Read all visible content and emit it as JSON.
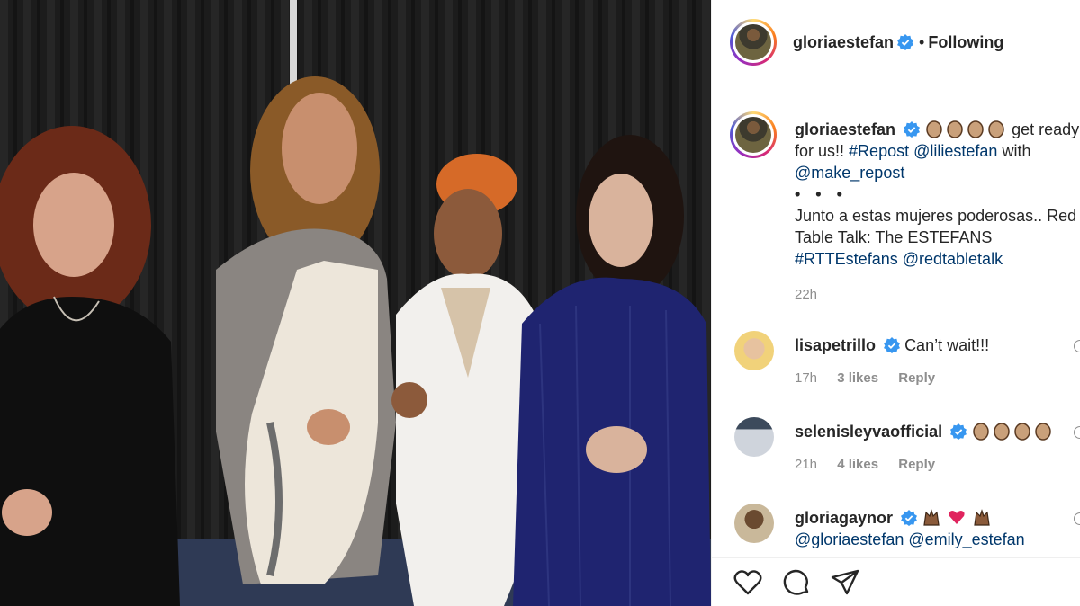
{
  "post": {
    "author": "gloriaestefan",
    "follow_status": "Following",
    "separator": "•"
  },
  "caption": {
    "author": "gloriaestefan",
    "text_1": "get ready",
    "text_2": "for us!!",
    "hashtag_repost": "#Repost",
    "mention_liliestefan": "@liliestefan",
    "with": "with",
    "mention_make_repost": "@make_repost",
    "dots": "• • •",
    "body_1": "Junto a estas mujeres poderosas.. Red",
    "body_2": "Table Talk: The ESTEFANS",
    "hashtag_rtt": "#RTTEstefans",
    "mention_redtabletalk": "@redtabletalk",
    "time": "22h"
  },
  "comments": [
    {
      "user": "lisapetrillo",
      "text": "Can’t wait!!!",
      "time": "17h",
      "likes": "3 likes",
      "reply": "Reply"
    },
    {
      "user": "selenisleyvaofficial",
      "text": "",
      "time": "21h",
      "likes": "4 likes",
      "reply": "Reply"
    },
    {
      "user": "gloriagaynor",
      "mention_1": "@gloriaestefan",
      "mention_2": "@emily_estefan"
    }
  ],
  "icons": {
    "like": "heart-icon",
    "comment": "comment-icon",
    "share": "share-icon",
    "verified": "verified-badge-icon"
  },
  "colors": {
    "link": "#00376b",
    "verified": "#3897f0",
    "meta": "#8e8e8e",
    "text": "#262626"
  }
}
